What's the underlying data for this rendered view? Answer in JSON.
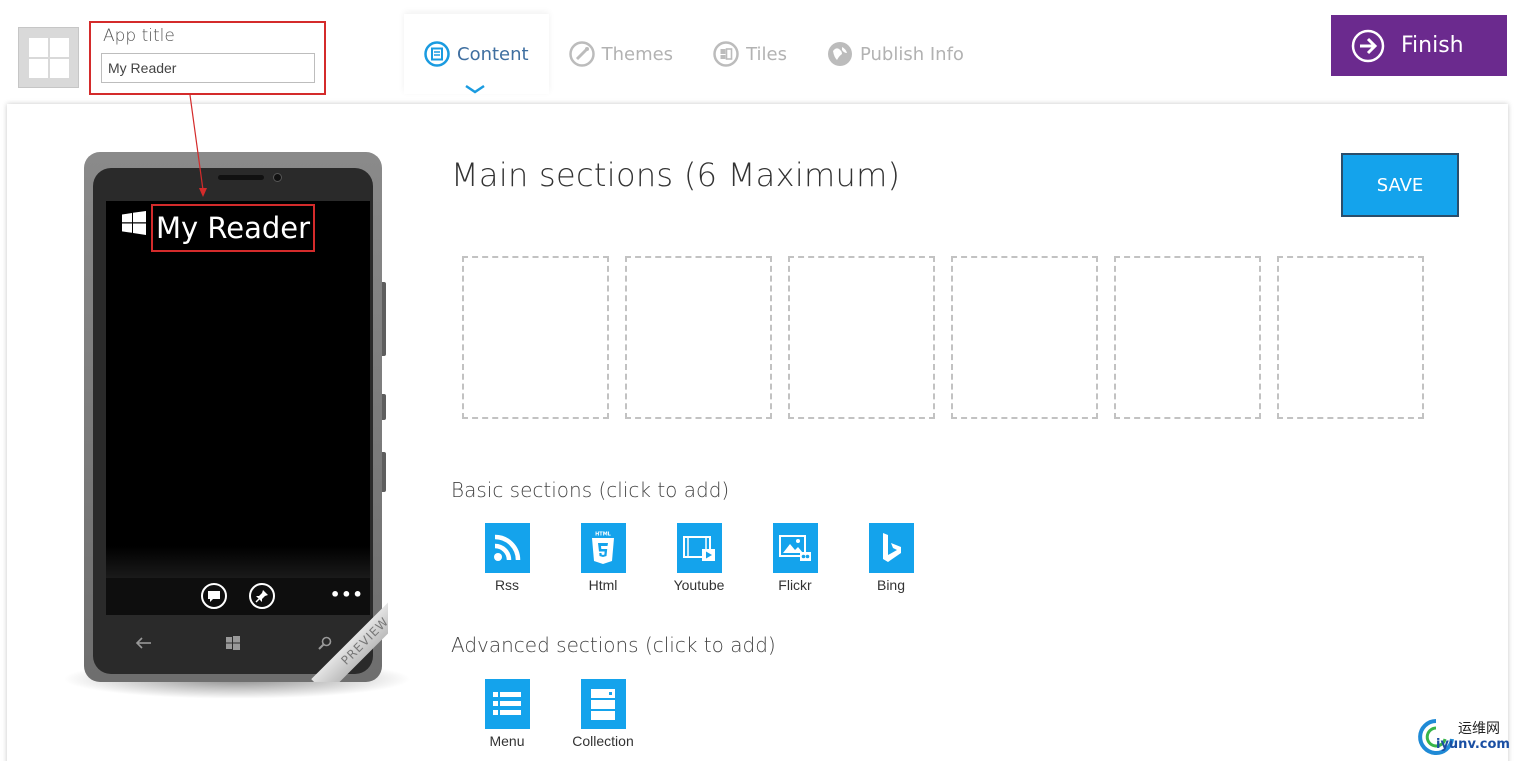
{
  "app_title": {
    "label": "App title",
    "value": "My Reader"
  },
  "tabs": [
    {
      "label": "Content",
      "icon": "content-icon",
      "active": true
    },
    {
      "label": "Themes",
      "icon": "themes-icon",
      "active": false
    },
    {
      "label": "Tiles",
      "icon": "tiles-icon",
      "active": false
    },
    {
      "label": "Publish Info",
      "icon": "publish-info-icon",
      "active": false
    }
  ],
  "finish": {
    "label": "Finish",
    "color": "#6b2a8e"
  },
  "phone": {
    "screen_title": "My Reader",
    "ribbon": "PREVIEW"
  },
  "main": {
    "heading": "Main sections (6 Maximum)",
    "save_label": "SAVE",
    "slot_count": 6,
    "basic_heading": "Basic sections (click to add)",
    "basic_sections": [
      {
        "label": "Rss",
        "icon": "rss-icon"
      },
      {
        "label": "Html",
        "icon": "html5-icon"
      },
      {
        "label": "Youtube",
        "icon": "video-icon"
      },
      {
        "label": "Flickr",
        "icon": "photo-icon"
      },
      {
        "label": "Bing",
        "icon": "bing-icon"
      }
    ],
    "advanced_heading": "Advanced sections (click to add)",
    "advanced_sections": [
      {
        "label": "Menu",
        "icon": "list-icon"
      },
      {
        "label": "Collection",
        "icon": "collection-icon"
      }
    ]
  },
  "watermark": {
    "cn": "运维网",
    "en": "iyunv.com"
  },
  "colors": {
    "accent": "#14a3ec",
    "finish": "#6b2a8e",
    "highlight": "#d42b2b",
    "tab_active": "#3f6fa0"
  }
}
